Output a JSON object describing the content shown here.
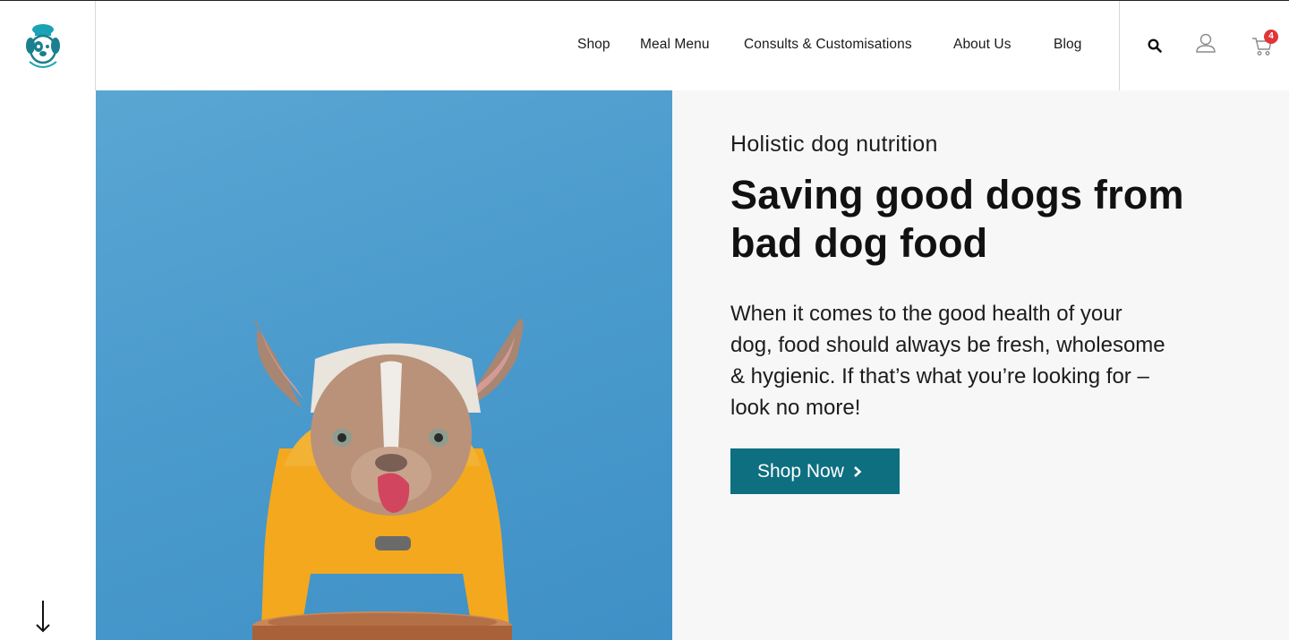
{
  "brand": {
    "logo_icon": "dog-chef-logo-icon",
    "accent": "#0e6f80",
    "logo_color": "#1aa3b5"
  },
  "nav": {
    "items": [
      {
        "label": "Shop"
      },
      {
        "label": "Meal Menu"
      },
      {
        "label": "Consults & Customisations"
      },
      {
        "label": "About Us"
      },
      {
        "label": "Blog"
      }
    ],
    "icons": [
      "search-icon",
      "user-icon",
      "cart-icon"
    ],
    "cart_count": "4",
    "cart_badge_color": "#e0363a"
  },
  "hero": {
    "eyebrow": "Holistic dog nutrition",
    "headline": "Saving good dogs from bad dog food",
    "body": "When it comes to the good health of your dog, food should always be fresh, wholesome & hygienic. If that’s what you’re looking for – look no more!",
    "cta_label": "Shop Now",
    "image_background": "#4b9bcd",
    "panel_background": "#f7f7f7"
  },
  "scroll_indicator": "down-arrow-icon"
}
